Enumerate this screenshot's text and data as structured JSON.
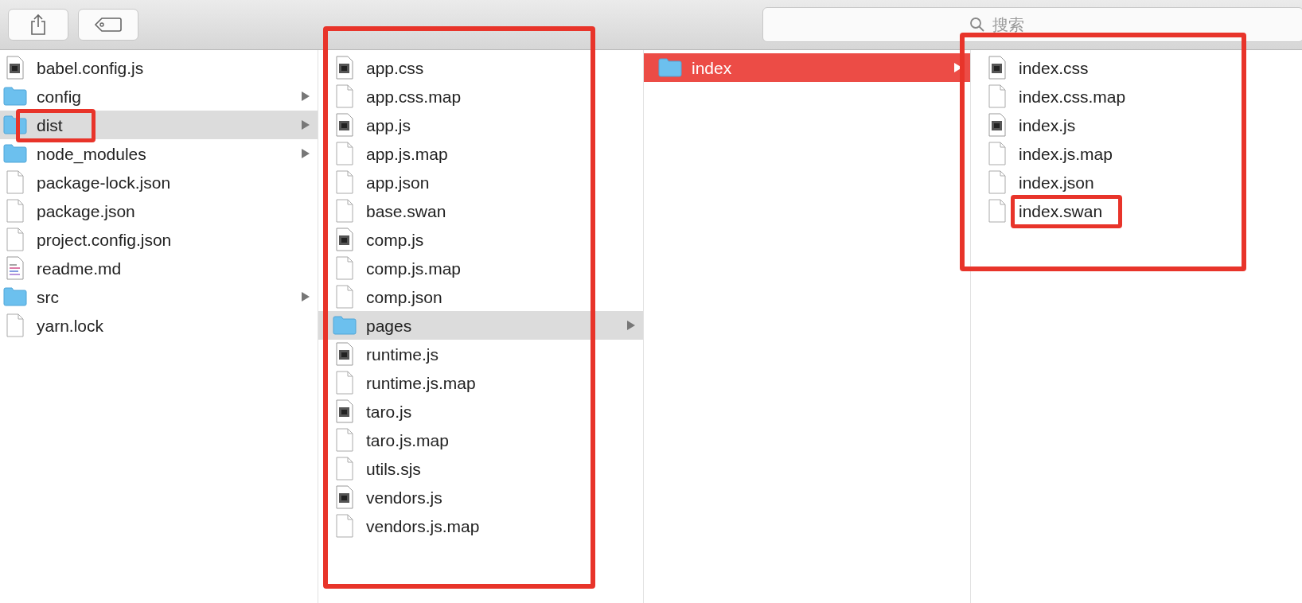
{
  "toolbar": {
    "search": {
      "placeholder": "搜索"
    }
  },
  "columns": [
    {
      "focused": false,
      "annotated": false,
      "items": [
        {
          "name": "babel.config.js",
          "kind": "exec",
          "selected": false,
          "annotated": false
        },
        {
          "name": "config",
          "kind": "folder",
          "selected": false,
          "annotated": false
        },
        {
          "name": "dist",
          "kind": "folder",
          "selected": true,
          "annotated": true
        },
        {
          "name": "node_modules",
          "kind": "folder",
          "selected": false,
          "annotated": false
        },
        {
          "name": "package-lock.json",
          "kind": "file",
          "selected": false,
          "annotated": false
        },
        {
          "name": "package.json",
          "kind": "file",
          "selected": false,
          "annotated": false
        },
        {
          "name": "project.config.json",
          "kind": "file",
          "selected": false,
          "annotated": false
        },
        {
          "name": "readme.md",
          "kind": "text",
          "selected": false,
          "annotated": false
        },
        {
          "name": "src",
          "kind": "folder",
          "selected": false,
          "annotated": false
        },
        {
          "name": "yarn.lock",
          "kind": "file",
          "selected": false,
          "annotated": false
        }
      ]
    },
    {
      "focused": false,
      "annotated": true,
      "items": [
        {
          "name": "app.css",
          "kind": "exec",
          "selected": false,
          "annotated": false
        },
        {
          "name": "app.css.map",
          "kind": "file",
          "selected": false,
          "annotated": false
        },
        {
          "name": "app.js",
          "kind": "exec",
          "selected": false,
          "annotated": false
        },
        {
          "name": "app.js.map",
          "kind": "file",
          "selected": false,
          "annotated": false
        },
        {
          "name": "app.json",
          "kind": "file",
          "selected": false,
          "annotated": false
        },
        {
          "name": "base.swan",
          "kind": "file",
          "selected": false,
          "annotated": false
        },
        {
          "name": "comp.js",
          "kind": "exec",
          "selected": false,
          "annotated": false
        },
        {
          "name": "comp.js.map",
          "kind": "file",
          "selected": false,
          "annotated": false
        },
        {
          "name": "comp.json",
          "kind": "file",
          "selected": false,
          "annotated": false
        },
        {
          "name": "pages",
          "kind": "folder",
          "selected": true,
          "annotated": false
        },
        {
          "name": "runtime.js",
          "kind": "exec",
          "selected": false,
          "annotated": false
        },
        {
          "name": "runtime.js.map",
          "kind": "file",
          "selected": false,
          "annotated": false
        },
        {
          "name": "taro.js",
          "kind": "exec",
          "selected": false,
          "annotated": false
        },
        {
          "name": "taro.js.map",
          "kind": "file",
          "selected": false,
          "annotated": false
        },
        {
          "name": "utils.sjs",
          "kind": "file",
          "selected": false,
          "annotated": false
        },
        {
          "name": "vendors.js",
          "kind": "exec",
          "selected": false,
          "annotated": false
        },
        {
          "name": "vendors.js.map",
          "kind": "file",
          "selected": false,
          "annotated": false
        }
      ]
    },
    {
      "focused": true,
      "annotated": false,
      "items": [
        {
          "name": "index",
          "kind": "folder",
          "selected": true,
          "annotated": false
        }
      ]
    },
    {
      "annotated": true,
      "items": [
        {
          "name": "index.css",
          "kind": "exec",
          "selected": false,
          "annotated": false
        },
        {
          "name": "index.css.map",
          "kind": "file",
          "selected": false,
          "annotated": false
        },
        {
          "name": "index.js",
          "kind": "exec",
          "selected": false,
          "annotated": false
        },
        {
          "name": "index.js.map",
          "kind": "file",
          "selected": false,
          "annotated": false
        },
        {
          "name": "index.json",
          "kind": "file",
          "selected": false,
          "annotated": false
        },
        {
          "name": "index.swan",
          "kind": "file",
          "selected": false,
          "annotated": true
        }
      ]
    }
  ]
}
